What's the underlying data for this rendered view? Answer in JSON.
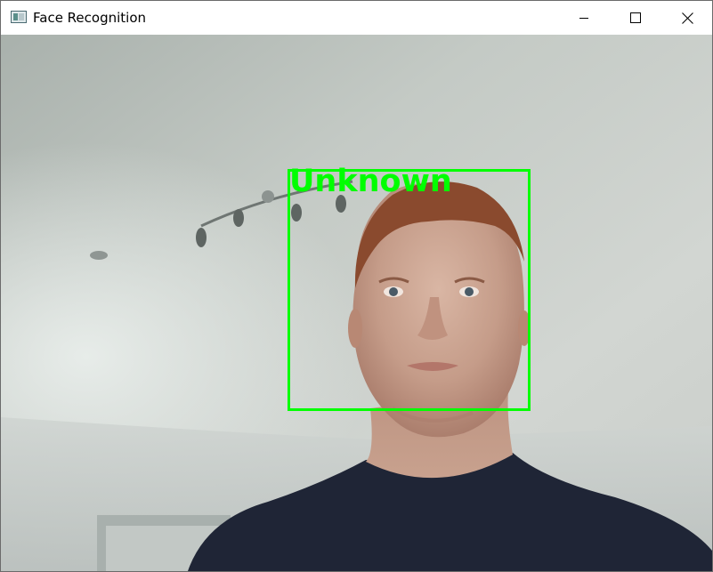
{
  "window": {
    "title": "Face Recognition",
    "icon": "opencv-window-icon",
    "controls": [
      "minimize-icon",
      "maximize-icon",
      "close-icon"
    ]
  },
  "detection": {
    "label": "Unknown",
    "box_color": "#00ff00"
  }
}
